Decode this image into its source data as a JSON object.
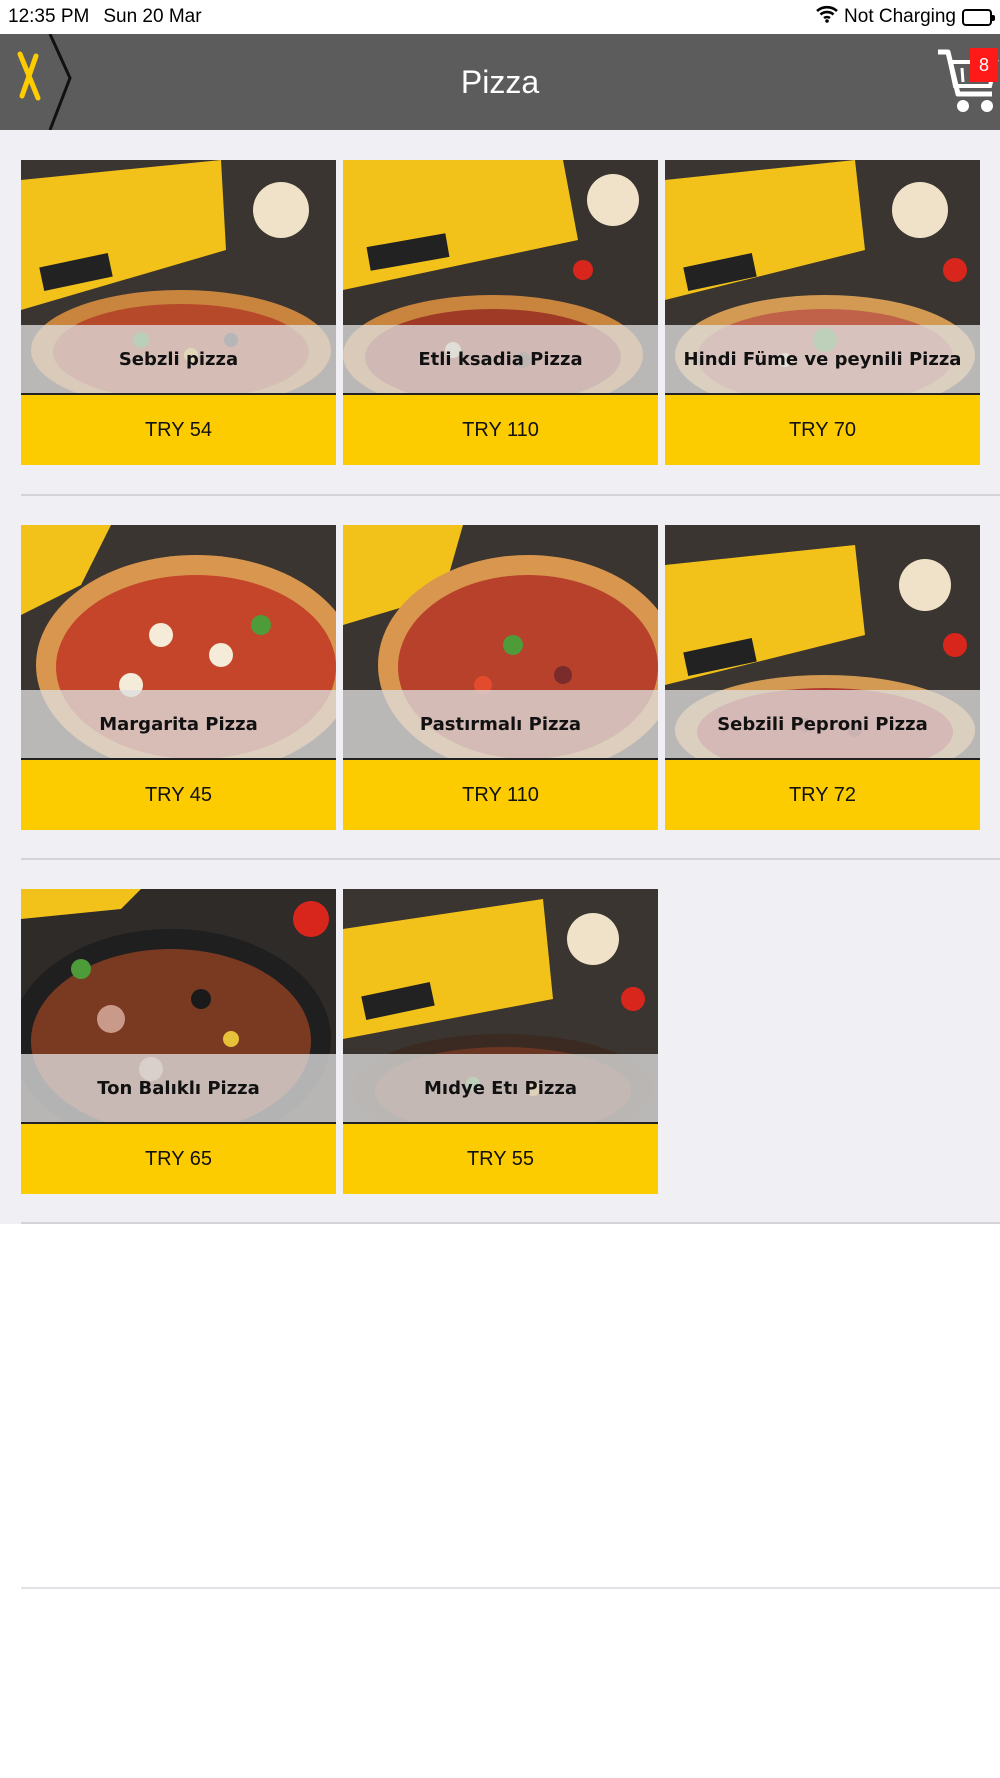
{
  "status_bar": {
    "time": "12:35 PM",
    "date": "Sun 20 Mar",
    "battery_text": "Not Charging",
    "wifi_icon": "wifi-icon",
    "battery_icon": "battery-icon"
  },
  "header": {
    "title": "Pizza",
    "logo_icon": "taxiway-logo-icon",
    "cart_icon": "cart-icon",
    "cart_count": "8"
  },
  "colors": {
    "header_bg": "#5c5c5c",
    "price_bg": "#fccc00",
    "badge_bg": "#ff1a1a",
    "content_bg": "#efeff4"
  },
  "products": [
    {
      "name": "Sebzli pizza",
      "price": "TRY 54"
    },
    {
      "name": "Etli ksadia Pizza",
      "price": "TRY 110"
    },
    {
      "name": "Hindi Füme ve peynili Pizza",
      "price": "TRY 70"
    },
    {
      "name": "Margarita Pizza",
      "price": "TRY 45"
    },
    {
      "name": "Pastırmalı Pizza",
      "price": "TRY 110"
    },
    {
      "name": "Sebzili Peproni Pizza",
      "price": "TRY 72"
    },
    {
      "name": "Ton Balıklı Pizza",
      "price": "TRY 65"
    },
    {
      "name": "Mıdye Etı Pizza",
      "price": "TRY 55"
    }
  ]
}
